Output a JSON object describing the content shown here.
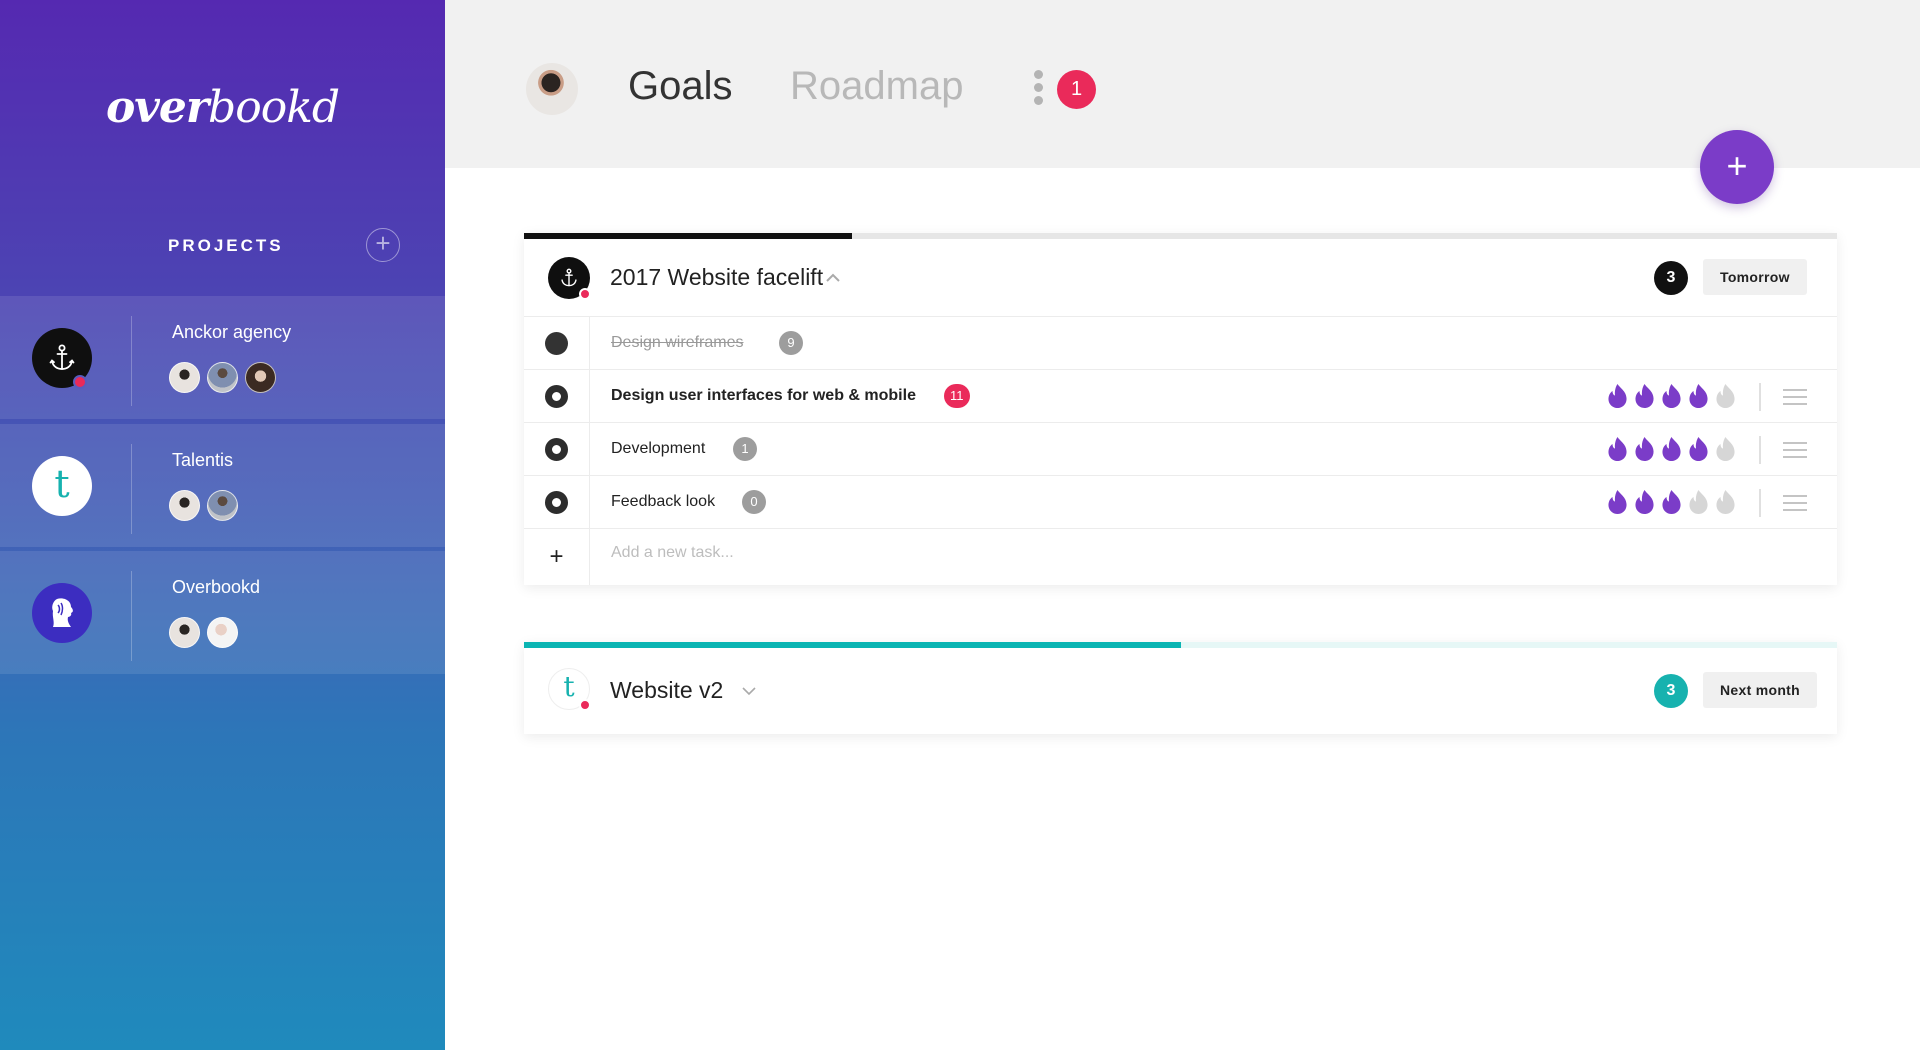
{
  "app": {
    "logo": {
      "bold_part": "over",
      "light_part": "bookd"
    }
  },
  "sidebar": {
    "section_label": "PROJECTS",
    "add_label": "+",
    "projects": [
      {
        "name": "Anckor agency",
        "icon": "anchor-icon",
        "logo_bg": "#0f0f0f",
        "has_notification": true,
        "members": [
          "member-1",
          "member-2",
          "member-3"
        ]
      },
      {
        "name": "Talentis",
        "icon": "t-letter-icon",
        "logo_bg": "#ffffff",
        "logo_letter": "t",
        "has_notification": false,
        "members": [
          "member-1",
          "member-2"
        ]
      },
      {
        "name": "Overbookd",
        "icon": "lion-icon",
        "logo_bg": "#3c2dc0",
        "has_notification": false,
        "members": [
          "member-1",
          "member-4"
        ]
      }
    ]
  },
  "header": {
    "tabs": [
      {
        "label": "Goals",
        "active": true
      },
      {
        "label": "Roadmap",
        "active": false
      }
    ],
    "notification_count": "1",
    "fab_label": "+"
  },
  "goals": [
    {
      "title": "2017 Website facelift",
      "expanded": true,
      "chevron": "^",
      "progress": 0.25,
      "progress_color": "#111111",
      "progress_track": "#e6e6e6",
      "count": "3",
      "count_color": "#111111",
      "due": "Tomorrow",
      "tasks": [
        {
          "name": "Design wireframes",
          "done": true,
          "comments": "9",
          "comments_highlight": false,
          "priority": null
        },
        {
          "name": "Design user interfaces for web & mobile",
          "done": false,
          "bold": true,
          "comments": "11",
          "comments_highlight": true,
          "priority": 4
        },
        {
          "name": "Development",
          "done": false,
          "comments": "1",
          "comments_highlight": false,
          "priority": 4
        },
        {
          "name": "Feedback look",
          "done": false,
          "comments": "0",
          "comments_highlight": false,
          "priority": 3
        }
      ],
      "priority_max": 5,
      "add_task_placeholder": "Add a new task..."
    },
    {
      "title": "Website v2",
      "expanded": false,
      "chevron": "v",
      "progress": 0.5,
      "progress_color": "#0bb5b3",
      "progress_track": "#e6f7f6",
      "count": "3",
      "count_color": "#17b2af",
      "due": "Next month",
      "logo_letter": "t"
    }
  ],
  "colors": {
    "accent_purple": "#7b3cc8",
    "flame_active": "#7b3cc8",
    "flame_inactive": "#d6d6d6",
    "notification_red": "#ea2a5a",
    "teal": "#17b2af"
  }
}
